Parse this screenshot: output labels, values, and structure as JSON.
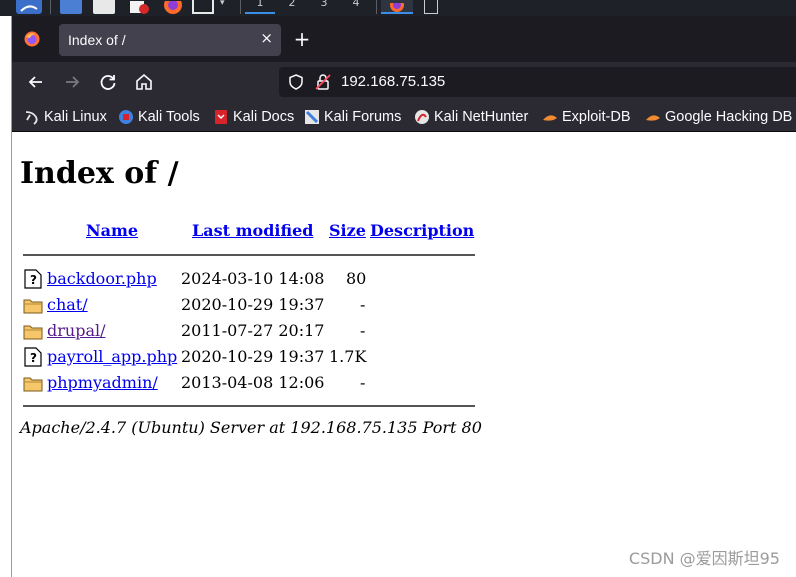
{
  "taskbar": {
    "workspaces": [
      "1",
      "2",
      "3",
      "4"
    ]
  },
  "browser": {
    "tab_title": "Index of /",
    "tab_close": "×",
    "new_tab": "+",
    "url": "192.168.75.135",
    "bookmarks": [
      {
        "label": "Kali Linux",
        "icon": "kali-dragon-icon"
      },
      {
        "label": "Kali Tools",
        "icon": "kali-tools-icon"
      },
      {
        "label": "Kali Docs",
        "icon": "kali-docs-icon"
      },
      {
        "label": "Kali Forums",
        "icon": "kali-forums-icon"
      },
      {
        "label": "Kali NetHunter",
        "icon": "kali-nethunter-icon"
      },
      {
        "label": "Exploit-DB",
        "icon": "exploit-db-icon"
      },
      {
        "label": "Google Hacking DB",
        "icon": "ghdb-icon"
      }
    ]
  },
  "page": {
    "heading": "Index of /",
    "columns": {
      "name": "Name",
      "last_modified": "Last modified",
      "size": "Size",
      "description": "Description"
    },
    "rows": [
      {
        "name": "backdoor.php",
        "modified": "2024-03-10 14:08",
        "size": "80",
        "icon": "unknown-file-icon"
      },
      {
        "name": "chat/",
        "modified": "2020-10-29 19:37",
        "size": "-",
        "icon": "folder-icon"
      },
      {
        "name": "drupal/",
        "modified": "2011-07-27 20:17",
        "size": "-",
        "icon": "folder-icon",
        "visited": true
      },
      {
        "name": "payroll_app.php",
        "modified": "2020-10-29 19:37",
        "size": "1.7K",
        "icon": "unknown-file-icon"
      },
      {
        "name": "phpmyadmin/",
        "modified": "2013-04-08 12:06",
        "size": "-",
        "icon": "folder-icon"
      }
    ],
    "address": "Apache/2.4.7 (Ubuntu) Server at 192.168.75.135 Port 80"
  },
  "watermark": "CSDN @爱因斯坦95",
  "colors": {
    "link": "#0000ee",
    "visited_link": "#551a8b",
    "chrome_dark": "#2b2a33",
    "tab_active": "#42414d"
  }
}
